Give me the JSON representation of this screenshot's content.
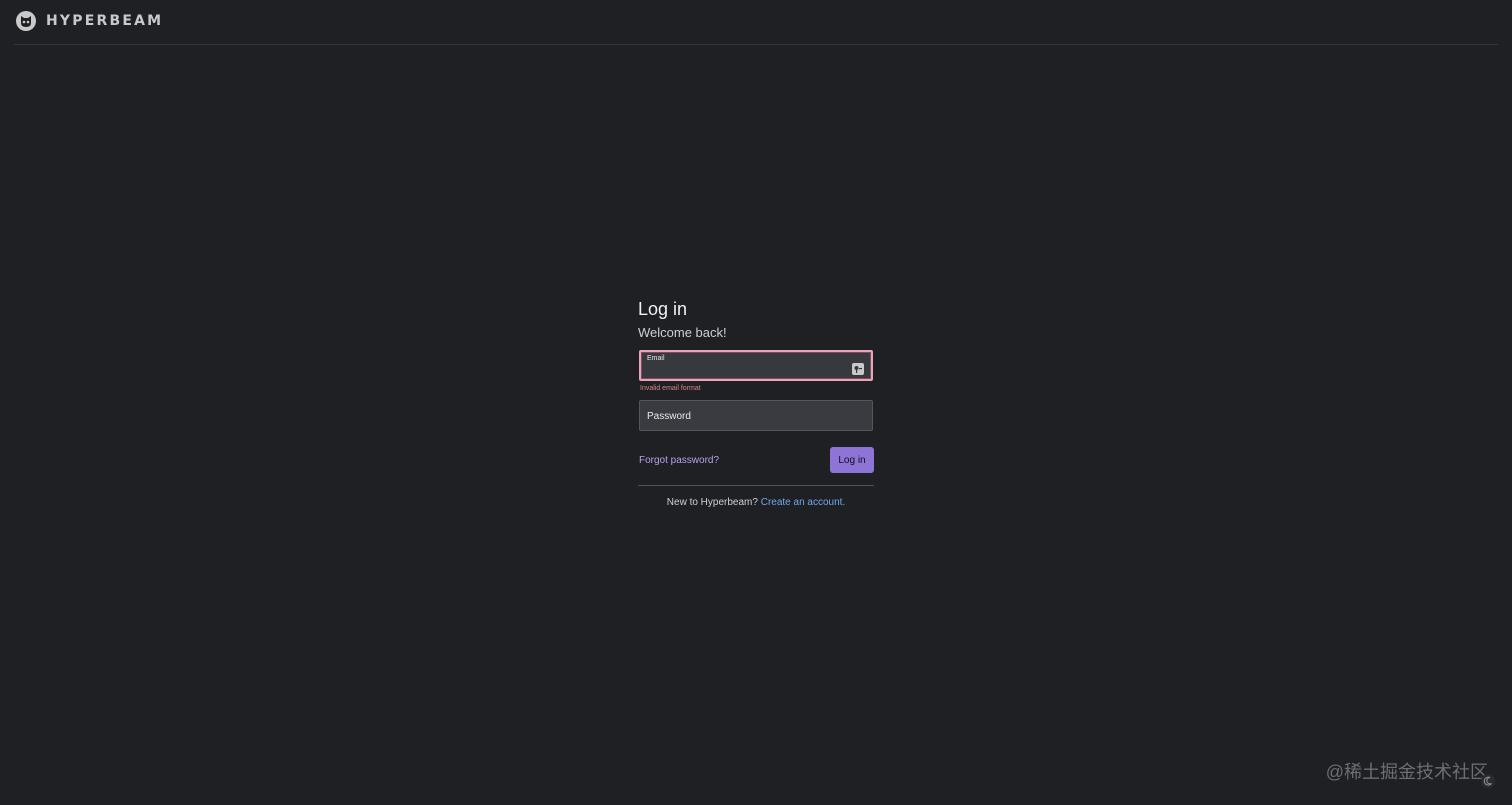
{
  "header": {
    "brand_name": "HYPERBEAM",
    "logo_icon": "hyperbeam-logo-icon"
  },
  "login": {
    "title": "Log in",
    "subtitle": "Welcome back!",
    "email": {
      "label": "Email",
      "value": "",
      "error": "Invalid email format",
      "icon": "password-manager-key-icon"
    },
    "password": {
      "placeholder": "Password",
      "value": ""
    },
    "forgot_password": "Forgot password?",
    "submit_label": "Log in",
    "signup_prompt": "New to Hyperbeam?",
    "signup_link": "Create an account."
  },
  "watermark": "@稀土掘金技术社区",
  "colors": {
    "background": "#1f2024",
    "accent": "#8e74d6",
    "error_border": "#e8a5ba",
    "error_text": "#d98585",
    "link": "#6fa9e6"
  }
}
